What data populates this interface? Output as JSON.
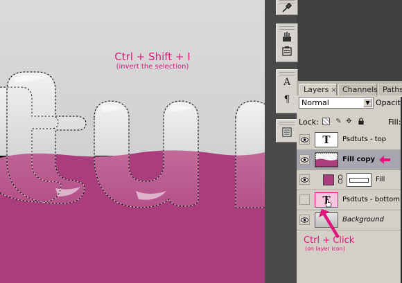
{
  "canvas": {
    "instruction_title": "Ctrl + Shift + I",
    "instruction_sub": "(invert the selection)",
    "fill_color": "#aa3d7c",
    "bg_top": "#dadada"
  },
  "tools": {
    "icons": [
      "eyedropper-tool-icon",
      "brush-presets-icon",
      "tool-presets-icon",
      "character-panel-icon",
      "paragraph-panel-icon",
      "layer-comps-icon"
    ],
    "character_glyph": "A",
    "paragraph_glyph": "¶"
  },
  "layers_panel": {
    "tabs": [
      {
        "label": "Layers",
        "close": "×"
      },
      {
        "label": "Channels"
      },
      {
        "label": "Paths"
      }
    ],
    "blend_mode": "Normal",
    "opacity_label": "Opacity:",
    "lock_label": "Lock:",
    "fill_label": "Fill:",
    "layers": [
      {
        "name": "Psdtuts - top",
        "type": "text",
        "thumb_glyph": "T",
        "visible": true
      },
      {
        "name": "Fill copy",
        "type": "image",
        "visible": true,
        "selected": true
      },
      {
        "name": "Fill",
        "type": "fill",
        "visible": true
      },
      {
        "name": "Psdtuts - bottom",
        "type": "text",
        "thumb_glyph": "T",
        "visible": false
      },
      {
        "name": "Background",
        "type": "background",
        "visible": true
      }
    ]
  },
  "annotation": {
    "title": "Ctrl + Click",
    "sub": "(on layer icon)",
    "color": "#e0147b"
  }
}
